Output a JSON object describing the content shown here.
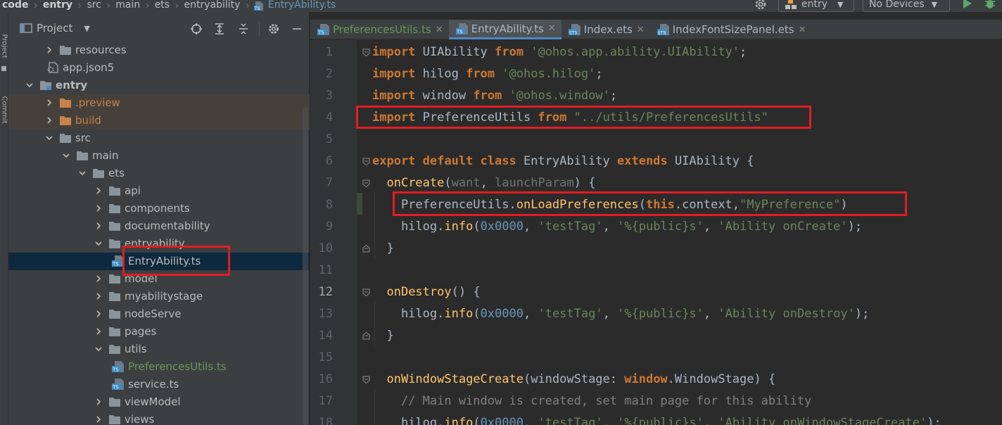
{
  "navbar": {
    "crumbs": [
      "code",
      "entry",
      "src",
      "main",
      "ets",
      "entryability",
      "EntryAbility.ts"
    ],
    "module_combo": "entry",
    "device_combo": "No Devices"
  },
  "left_stripe": {
    "project_label": "Project",
    "commit_label": "Commit"
  },
  "project_panel": {
    "title": "Project",
    "tree": [
      {
        "label": "resources",
        "type": "folder",
        "depth": 2,
        "arrow": "right"
      },
      {
        "label": "app.json5",
        "type": "json",
        "depth": 2,
        "arrow": "none"
      },
      {
        "label": "entry",
        "type": "module",
        "depth": 1,
        "arrow": "down",
        "bold": true
      },
      {
        "label": ".preview",
        "type": "folder-orange",
        "depth": 2,
        "arrow": "right",
        "color": "orange"
      },
      {
        "label": "build",
        "type": "folder-orange",
        "depth": 2,
        "arrow": "right",
        "color": "orange"
      },
      {
        "label": "src",
        "type": "folder",
        "depth": 2,
        "arrow": "down"
      },
      {
        "label": "main",
        "type": "folder",
        "depth": 3,
        "arrow": "down"
      },
      {
        "label": "ets",
        "type": "folder",
        "depth": 4,
        "arrow": "down"
      },
      {
        "label": "api",
        "type": "folder",
        "depth": 5,
        "arrow": "right"
      },
      {
        "label": "components",
        "type": "folder",
        "depth": 5,
        "arrow": "right"
      },
      {
        "label": "documentability",
        "type": "folder",
        "depth": 5,
        "arrow": "right"
      },
      {
        "label": "entryability",
        "type": "folder",
        "depth": 5,
        "arrow": "down"
      },
      {
        "label": "EntryAbility.ts",
        "type": "ts",
        "depth": 6,
        "arrow": "none",
        "selected": true
      },
      {
        "label": "model",
        "type": "folder",
        "depth": 5,
        "arrow": "right"
      },
      {
        "label": "myabilitystage",
        "type": "folder",
        "depth": 5,
        "arrow": "right"
      },
      {
        "label": "nodeServe",
        "type": "folder",
        "depth": 5,
        "arrow": "right"
      },
      {
        "label": "pages",
        "type": "folder",
        "depth": 5,
        "arrow": "right"
      },
      {
        "label": "utils",
        "type": "folder",
        "depth": 5,
        "arrow": "down"
      },
      {
        "label": "PreferencesUtils.ts",
        "type": "ts",
        "depth": 6,
        "arrow": "none",
        "color": "green"
      },
      {
        "label": "service.ts",
        "type": "ts",
        "depth": 6,
        "arrow": "none"
      },
      {
        "label": "viewModel",
        "type": "folder",
        "depth": 5,
        "arrow": "right"
      },
      {
        "label": "views",
        "type": "folder",
        "depth": 5,
        "arrow": "right"
      }
    ]
  },
  "tabs": [
    {
      "label": "PreferencesUtils.ts",
      "icon": "ts",
      "active": false,
      "color": "green"
    },
    {
      "label": "EntryAbility.ts",
      "icon": "ts",
      "active": true,
      "color": "blue"
    },
    {
      "label": "Index.ets",
      "icon": "ets",
      "active": false,
      "color": "blue"
    },
    {
      "label": "IndexFontSizePanel.ets",
      "icon": "ets",
      "active": false,
      "color": "blue"
    }
  ],
  "editor": {
    "current_line": 12,
    "lines": [
      [
        [
          "kw",
          "import"
        ],
        [
          "ident",
          " UIAbility "
        ],
        [
          "kw",
          "from"
        ],
        [
          "ident",
          " "
        ],
        [
          "str",
          "'@ohos.app.ability.UIAbility'"
        ],
        [
          "ident",
          ";"
        ]
      ],
      [
        [
          "kw",
          "import"
        ],
        [
          "ident",
          " hilog "
        ],
        [
          "kw",
          "from"
        ],
        [
          "ident",
          " "
        ],
        [
          "str",
          "'@ohos.hilog'"
        ],
        [
          "ident",
          ";"
        ]
      ],
      [
        [
          "kw",
          "import"
        ],
        [
          "ident",
          " window "
        ],
        [
          "kw",
          "from"
        ],
        [
          "ident",
          " "
        ],
        [
          "str",
          "'@ohos.window'"
        ],
        [
          "ident",
          ";"
        ]
      ],
      [
        [
          "kw",
          "import"
        ],
        [
          "ident",
          " PreferenceUtils "
        ],
        [
          "kw",
          "from"
        ],
        [
          "ident",
          " "
        ],
        [
          "str",
          "\"../utils/PreferencesUtils\""
        ]
      ],
      [],
      [
        [
          "kw",
          "export default class"
        ],
        [
          "ident",
          " EntryAbility "
        ],
        [
          "kw",
          "extends"
        ],
        [
          "ident",
          " UIAbility {"
        ]
      ],
      [
        [
          "ident",
          "  "
        ],
        [
          "fn",
          "onCreate"
        ],
        [
          "ident",
          "("
        ],
        [
          "prm",
          "want"
        ],
        [
          "ident",
          ", "
        ],
        [
          "prm",
          "launchParam"
        ],
        [
          "ident",
          ") {"
        ]
      ],
      [
        [
          "ident",
          "    PreferenceUtils."
        ],
        [
          "fn",
          "onLoadPreferences"
        ],
        [
          "ident",
          "("
        ],
        [
          "kw",
          "this"
        ],
        [
          "ident",
          ".context,"
        ],
        [
          "str",
          "\"MyPreference\""
        ],
        [
          "ident",
          ")"
        ]
      ],
      [
        [
          "ident",
          "    hilog."
        ],
        [
          "fn",
          "info"
        ],
        [
          "ident",
          "("
        ],
        [
          "num",
          "0x0000"
        ],
        [
          "ident",
          ", "
        ],
        [
          "str",
          "'testTag'"
        ],
        [
          "ident",
          ", "
        ],
        [
          "str",
          "'%{public}s'"
        ],
        [
          "ident",
          ", "
        ],
        [
          "str",
          "'Ability onCreate'"
        ],
        [
          "ident",
          ");"
        ]
      ],
      [
        [
          "ident",
          "  }"
        ]
      ],
      [],
      [
        [
          "ident",
          "  "
        ],
        [
          "fn",
          "onDestroy"
        ],
        [
          "ident",
          "() {"
        ]
      ],
      [
        [
          "ident",
          "    hilog."
        ],
        [
          "fn",
          "info"
        ],
        [
          "ident",
          "("
        ],
        [
          "num",
          "0x0000"
        ],
        [
          "ident",
          ", "
        ],
        [
          "str",
          "'testTag'"
        ],
        [
          "ident",
          ", "
        ],
        [
          "str",
          "'%{public}s'"
        ],
        [
          "ident",
          ", "
        ],
        [
          "str",
          "'Ability onDestroy'"
        ],
        [
          "ident",
          ");"
        ]
      ],
      [
        [
          "ident",
          "  }"
        ]
      ],
      [],
      [
        [
          "ident",
          "  "
        ],
        [
          "fn",
          "onWindowStageCreate"
        ],
        [
          "ident",
          "(windowStage: "
        ],
        [
          "kw",
          "window"
        ],
        [
          "ident",
          ".WindowStage) {"
        ]
      ],
      [
        [
          "cmt",
          "    // Main window is created, set main page for this ability"
        ]
      ],
      [
        [
          "ident",
          "    hilog."
        ],
        [
          "fn",
          "info"
        ],
        [
          "ident",
          "("
        ],
        [
          "num",
          "0x0000"
        ],
        [
          "ident",
          ", "
        ],
        [
          "str",
          "'testTag'"
        ],
        [
          "ident",
          ", "
        ],
        [
          "str",
          "'%{public}s'"
        ],
        [
          "ident",
          ", "
        ],
        [
          "str",
          "'Ability onWindowStageCreate'"
        ],
        [
          "ident",
          ");"
        ]
      ]
    ]
  }
}
